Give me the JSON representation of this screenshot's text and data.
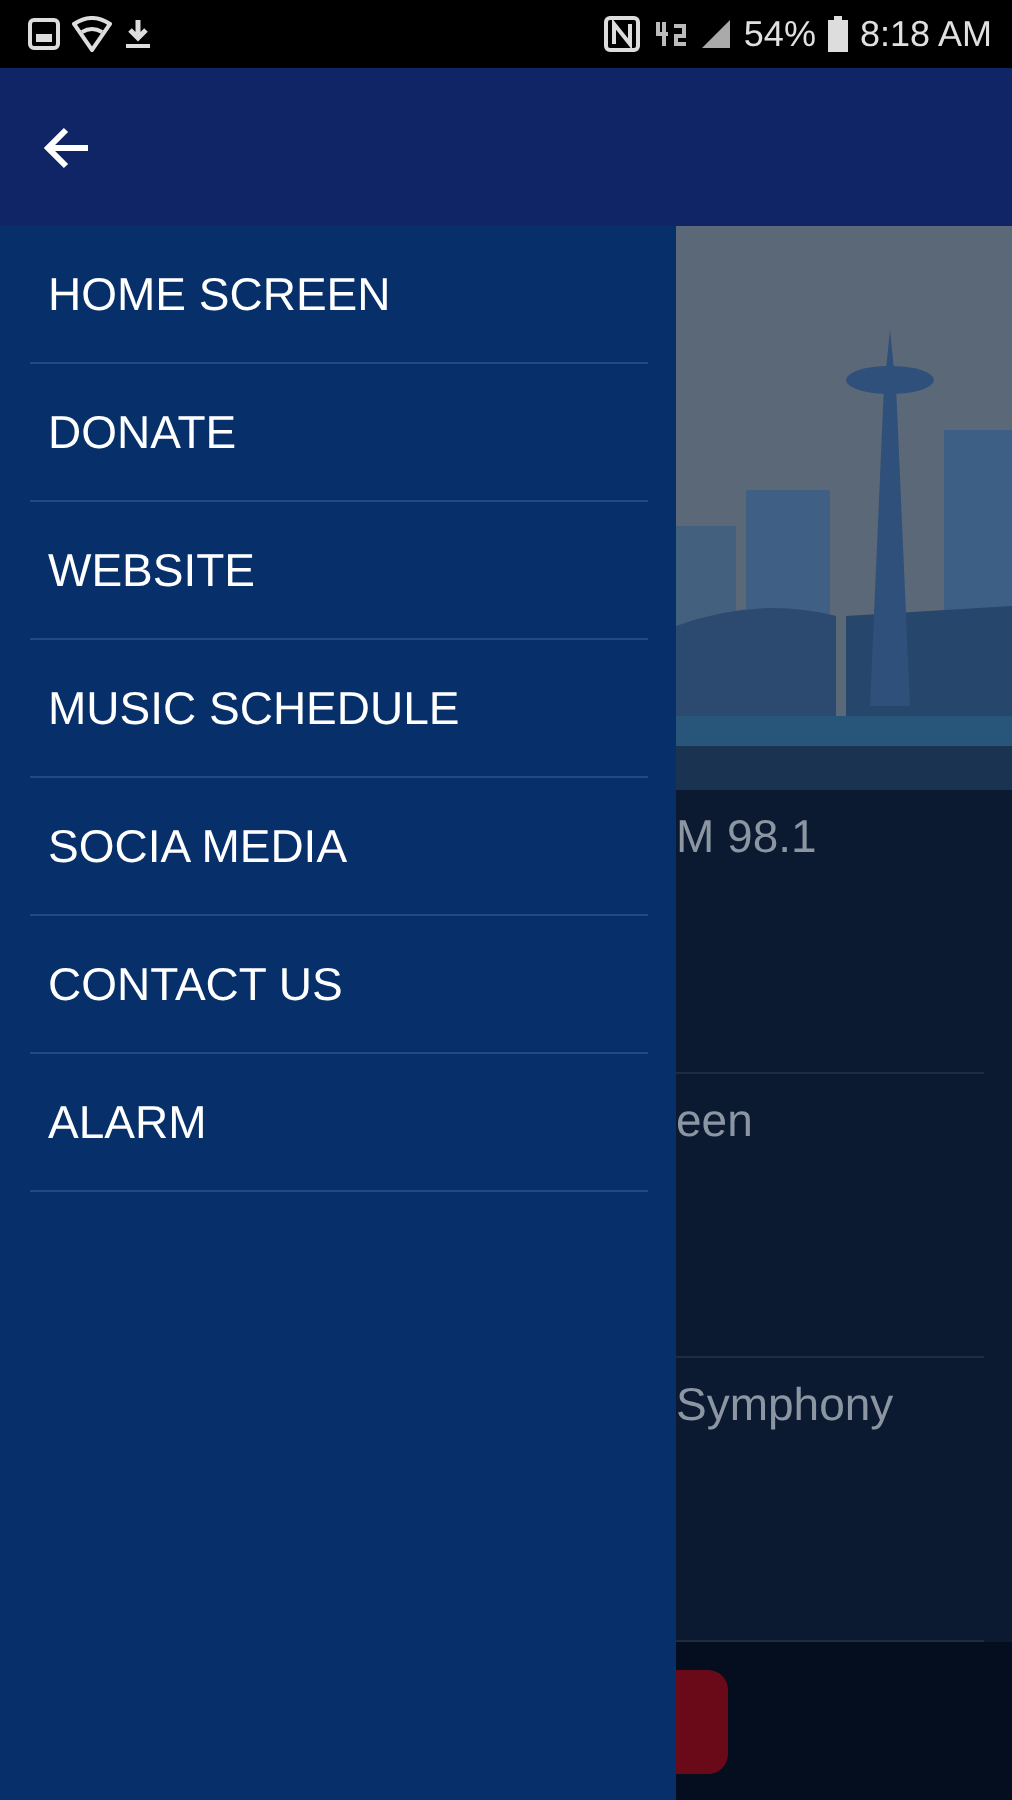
{
  "status_bar": {
    "battery": "54%",
    "time": "8:18 AM"
  },
  "drawer": {
    "items": [
      {
        "label": "HOME SCREEN"
      },
      {
        "label": "DONATE"
      },
      {
        "label": "WEBSITE"
      },
      {
        "label": "MUSIC SCHEDULE"
      },
      {
        "label": "SOCIA MEDIA"
      },
      {
        "label": "CONTACT US"
      },
      {
        "label": "ALARM"
      }
    ]
  },
  "behind": {
    "rows": [
      "M 98.1",
      "een",
      "Symphony"
    ]
  }
}
